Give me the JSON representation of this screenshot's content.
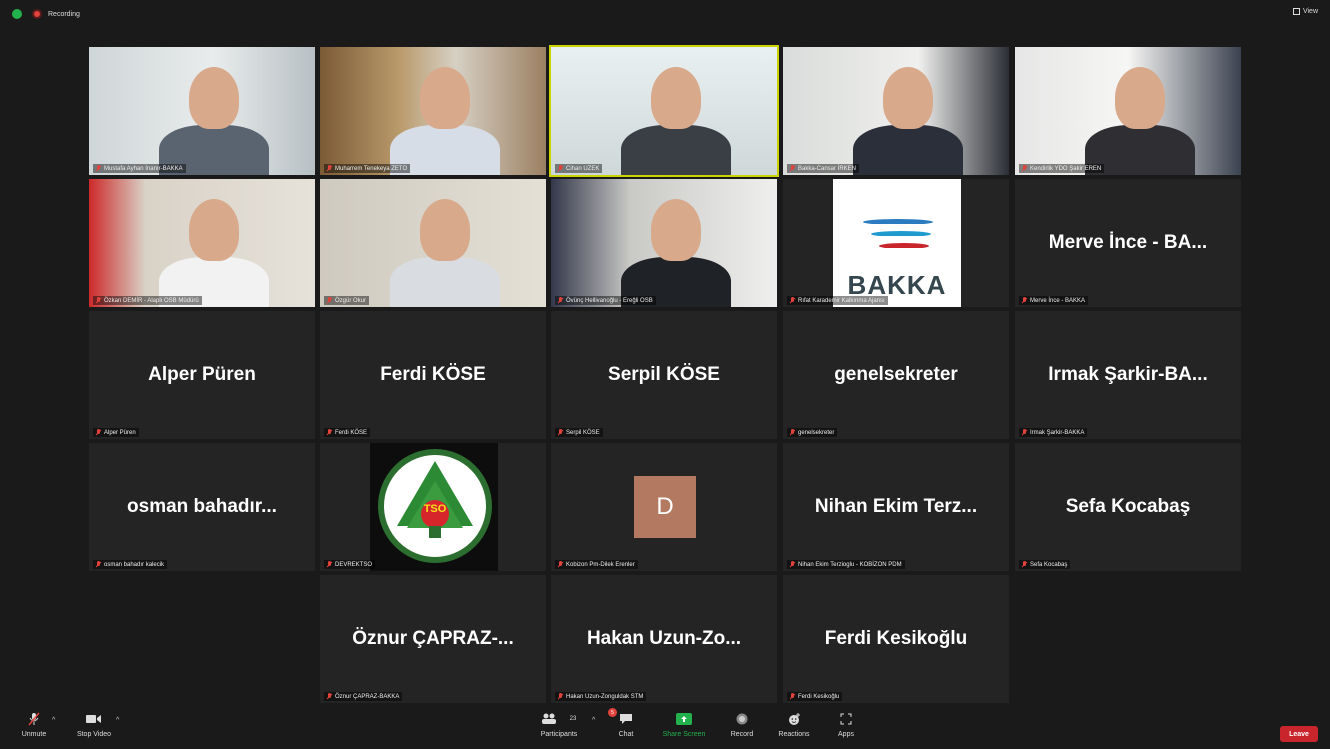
{
  "topbar": {
    "recording_label": "Recording",
    "view_label": "View"
  },
  "tiles": [
    {
      "label": "Mustafa Ayhan İnanır-BAKKA",
      "big": "",
      "kind": "video"
    },
    {
      "label": "Muharrem Tenekeya ZETO",
      "big": "",
      "kind": "video"
    },
    {
      "label": "Cihan UZEK",
      "big": "",
      "kind": "video",
      "active": true
    },
    {
      "label": "Bakka-Cansar İRKEN",
      "big": "",
      "kind": "video"
    },
    {
      "label": "Kendirlik YDO Şakir EREN",
      "big": "",
      "kind": "video"
    },
    {
      "label": "Özkan DEMİR - Alaplı OSB Müdürü",
      "big": "",
      "kind": "video"
    },
    {
      "label": "Özgür Okur",
      "big": "",
      "kind": "video"
    },
    {
      "label": "Övünç Hellivanoğlu - Ereğli OSB",
      "big": "",
      "kind": "video"
    },
    {
      "label": "Rıfat Karademir Kalkınma Ajansı",
      "big": "",
      "kind": "logo-bakka",
      "logo_text": "BAKKA"
    },
    {
      "label": "Merve İnce - BAKKA",
      "big": "Merve İnce - BA...",
      "kind": "name"
    },
    {
      "label": "Alper Püren",
      "big": "Alper Püren",
      "kind": "name"
    },
    {
      "label": "Ferdi KÖSE",
      "big": "Ferdi KÖSE",
      "kind": "name"
    },
    {
      "label": "Serpil KÖSE",
      "big": "Serpil KÖSE",
      "kind": "name"
    },
    {
      "label": "genelsekreter",
      "big": "genelsekreter",
      "kind": "name"
    },
    {
      "label": "Irmak Şarkir-BAKKA",
      "big": "Irmak Şarkir-BA...",
      "kind": "name"
    },
    {
      "label": "osman bahadır kalecik",
      "big": "osman bahadır...",
      "kind": "name"
    },
    {
      "label": "DEVREKTSO",
      "big": "",
      "kind": "logo-tso",
      "logo_text": "TSO"
    },
    {
      "label": "Kobizon Pm-Dilek Erenler",
      "big": "D",
      "kind": "avatar"
    },
    {
      "label": "Nihan Ekim Terzioglu - KOBİZON PDM",
      "big": "Nihan Ekim Terz...",
      "kind": "name"
    },
    {
      "label": "Sefa Kocabaş",
      "big": "Sefa Kocabaş",
      "kind": "name"
    },
    {
      "label": "Öznur ÇAPRAZ-BAKKA",
      "big": "Öznur ÇAPRAZ-...",
      "kind": "name"
    },
    {
      "label": "Hakan Uzun-Zonguldak STM",
      "big": "Hakan Uzun-Zo...",
      "kind": "name"
    },
    {
      "label": "Ferdi Kesikoğlu",
      "big": "Ferdi Kesikoğlu",
      "kind": "name"
    }
  ],
  "toolbar": {
    "unmute": "Unmute",
    "stop_video": "Stop Video",
    "participants": "Participants",
    "participants_count": "23",
    "chat": "Chat",
    "chat_badge": "5",
    "share_screen": "Share Screen",
    "record": "Record",
    "reactions": "Reactions",
    "apps": "Apps",
    "leave": "Leave"
  },
  "colors": {
    "background": "#1a1a1a",
    "tile": "#242424",
    "active_outline": "#c9d400",
    "share_green": "#23b14d",
    "leave_red": "#c8262c",
    "muted_red": "#e0433b"
  }
}
